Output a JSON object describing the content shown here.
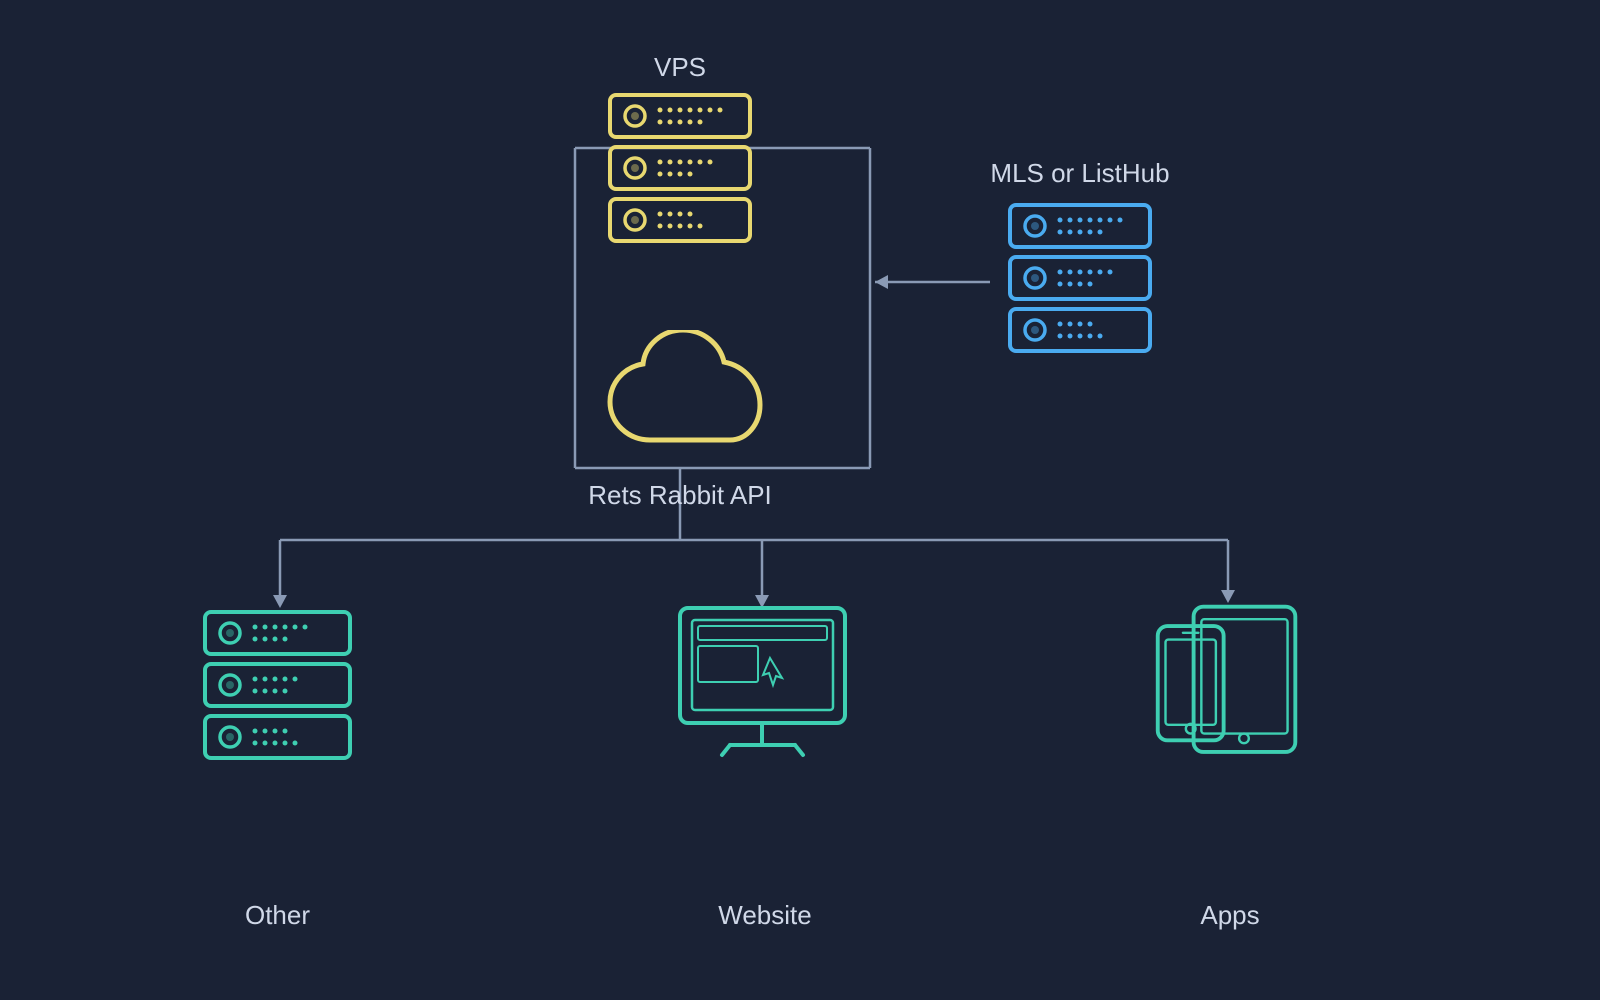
{
  "labels": {
    "vps": "VPS",
    "mls": "MLS or ListHub",
    "api": "Rets Rabbit API",
    "other": "Other",
    "website": "Website",
    "apps": "Apps"
  },
  "colors": {
    "background": "#1a2235",
    "vps_color": "#e8d870",
    "mls_color": "#4aabf0",
    "teal_color": "#3ecfb2",
    "line_color": "#8a9ab5",
    "label_color": "#d0d8e8",
    "arrow_color": "#8a9ab5"
  }
}
